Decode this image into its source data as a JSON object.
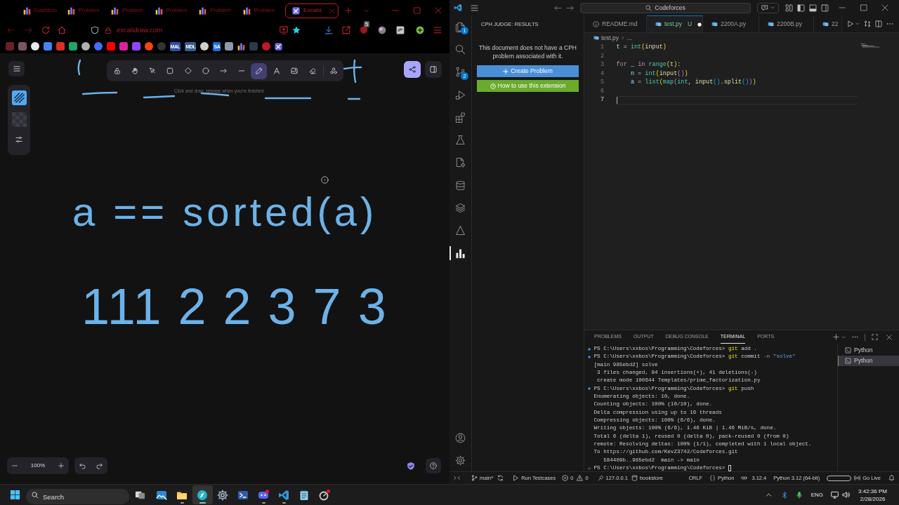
{
  "browser": {
    "tabs": [
      {
        "label": "Dashboo",
        "kind": "chart",
        "selected": false
      },
      {
        "label": "Problem",
        "kind": "chart",
        "selected": false
      },
      {
        "label": "Problem",
        "kind": "chart",
        "selected": false
      },
      {
        "label": "Problem",
        "kind": "chart",
        "selected": false
      },
      {
        "label": "Problem",
        "kind": "chart",
        "selected": false
      },
      {
        "label": "Problem",
        "kind": "chart",
        "selected": false
      },
      {
        "label": "Excalid",
        "kind": "excalidraw",
        "selected": true
      }
    ],
    "address": "excalidraw.com",
    "extension_badge": "5",
    "bookmarks": [
      {
        "kind": "tile",
        "color": "#6b1e28"
      },
      {
        "kind": "tile",
        "color": "#7a5560"
      },
      {
        "kind": "round",
        "color": "#e8eaed"
      },
      {
        "kind": "tile",
        "color": "#4285f4"
      },
      {
        "kind": "tile",
        "color": "#d93025"
      },
      {
        "kind": "tile",
        "color": "#1fa463"
      },
      {
        "kind": "round",
        "color": "#b0b0b0"
      },
      {
        "kind": "round",
        "color": "#4a6cf7"
      },
      {
        "kind": "tile",
        "color": "#ff0000"
      },
      {
        "kind": "tile",
        "color": "#d6249f"
      },
      {
        "kind": "tile",
        "color": "#9146ff"
      },
      {
        "kind": "round",
        "color": "#ff4500"
      },
      {
        "kind": "round",
        "color": "#333333"
      },
      {
        "kind": "label",
        "label": "MAL",
        "color": "#2e51a2"
      },
      {
        "kind": "label",
        "label": "MDL",
        "color": "#345f8f"
      },
      {
        "kind": "round",
        "color": "#cfcfcf"
      },
      {
        "kind": "label",
        "label": "SA",
        "color": "#1e6fd9"
      },
      {
        "kind": "tile",
        "color": "#8a9ba8"
      },
      {
        "kind": "chart"
      },
      {
        "kind": "tile",
        "color": "#2b3a4a"
      },
      {
        "kind": "round",
        "color": "#c0182a"
      },
      {
        "kind": "excalidraw"
      }
    ]
  },
  "excalidraw": {
    "tools": [
      {
        "kind": "lock",
        "selected": false
      },
      {
        "kind": "hand",
        "selected": false
      },
      {
        "kind": "selection",
        "selected": false
      },
      {
        "kind": "rectangle",
        "selected": false
      },
      {
        "kind": "diamond",
        "selected": false
      },
      {
        "kind": "ellipse",
        "selected": false
      },
      {
        "kind": "arrow",
        "selected": false
      },
      {
        "kind": "line",
        "selected": false
      },
      {
        "kind": "pencil",
        "selected": true
      },
      {
        "kind": "text",
        "selected": false
      },
      {
        "kind": "image",
        "selected": false
      },
      {
        "kind": "eraser",
        "selected": false
      },
      {
        "kind": "more",
        "selected": false
      }
    ],
    "hint": "Click and drag, release when you're finished",
    "drawing_texts": [
      "a == sorted(a)",
      "111 2 2 3 7 3"
    ],
    "zoom": "100%"
  },
  "vscode": {
    "command_center": "Codeforces",
    "activity": [
      {
        "kind": "explorer",
        "badge": "1",
        "selected": false
      },
      {
        "kind": "search",
        "selected": false
      },
      {
        "kind": "source_control",
        "badge": "2",
        "selected": false
      },
      {
        "kind": "run",
        "selected": false
      },
      {
        "kind": "extensions",
        "selected": false
      },
      {
        "kind": "testing",
        "selected": false
      },
      {
        "kind": "file_settings",
        "selected": false
      },
      {
        "kind": "database",
        "selected": false
      },
      {
        "kind": "layers",
        "selected": false
      },
      {
        "kind": "triangle",
        "selected": false
      },
      {
        "kind": "chart",
        "selected": true
      }
    ],
    "sidebar": {
      "title": "CPH JUDGE: RESULTS",
      "message": "This document does not have a CPH problem associated with it.",
      "buttons": [
        {
          "label": "Create Problem",
          "kind": "create"
        },
        {
          "label": "How to use this extension",
          "kind": "help"
        }
      ]
    },
    "editor_tabs": [
      {
        "label": "README.md",
        "kind": "info",
        "selected": false,
        "dirty": false
      },
      {
        "label": "test.py",
        "kind": "python",
        "selected": true,
        "status": "U",
        "dirty": true
      },
      {
        "label": "2200A.py",
        "kind": "python",
        "selected": false,
        "dirty": false
      },
      {
        "label": "2200B.py",
        "kind": "python",
        "selected": false,
        "dirty": false
      },
      {
        "label": "22",
        "kind": "python",
        "selected": false,
        "dirty": false
      }
    ],
    "breadcrumb": [
      "test.py",
      "..."
    ],
    "code": [
      {
        "number": "1",
        "current": false,
        "tokens": [
          {
            "text": "t",
            "kind": "var"
          },
          {
            "text": " = ",
            "kind": "op"
          },
          {
            "text": "int",
            "kind": "builtin"
          },
          {
            "text": "(",
            "kind": "paren1"
          },
          {
            "text": "input",
            "kind": "func"
          },
          {
            "text": ")",
            "kind": "paren1"
          }
        ]
      },
      {
        "number": "2",
        "current": false
      },
      {
        "number": "3",
        "current": false,
        "tokens": [
          {
            "text": "for",
            "kind": "keyword"
          },
          {
            "text": " _ ",
            "kind": "var"
          },
          {
            "text": "in",
            "kind": "keyword"
          },
          {
            "text": " range",
            "kind": "builtin"
          },
          {
            "text": "(",
            "kind": "paren1"
          },
          {
            "text": "t",
            "kind": "var"
          },
          {
            "text": ")",
            "kind": "paren1"
          },
          {
            "text": ":",
            "kind": "op"
          }
        ]
      },
      {
        "number": "4",
        "current": false,
        "tokens": [
          {
            "text": "    n",
            "kind": "var"
          },
          {
            "text": " = ",
            "kind": "op"
          },
          {
            "text": "int",
            "kind": "builtin"
          },
          {
            "text": "(",
            "kind": "paren1"
          },
          {
            "text": "input",
            "kind": "func"
          },
          {
            "text": "(",
            "kind": "paren2"
          },
          {
            "text": ")",
            "kind": "paren2"
          },
          {
            "text": ")",
            "kind": "paren1"
          }
        ]
      },
      {
        "number": "5",
        "current": false,
        "tokens": [
          {
            "text": "    a",
            "kind": "var"
          },
          {
            "text": " = ",
            "kind": "op"
          },
          {
            "text": "list",
            "kind": "builtin"
          },
          {
            "text": "(",
            "kind": "paren1"
          },
          {
            "text": "map",
            "kind": "builtin"
          },
          {
            "text": "(",
            "kind": "paren2"
          },
          {
            "text": "int",
            "kind": "builtin"
          },
          {
            "text": ", ",
            "kind": "op"
          },
          {
            "text": "input",
            "kind": "func"
          },
          {
            "text": "(",
            "kind": "paren3"
          },
          {
            "text": ")",
            "kind": "paren3"
          },
          {
            "text": ".",
            "kind": "op"
          },
          {
            "text": "split",
            "kind": "func"
          },
          {
            "text": "(",
            "kind": "paren3"
          },
          {
            "text": ")",
            "kind": "paren3"
          },
          {
            "text": ")",
            "kind": "paren2"
          },
          {
            "text": ")",
            "kind": "paren1"
          }
        ]
      },
      {
        "number": "6",
        "current": false
      },
      {
        "number": "7",
        "current": true
      }
    ],
    "panel": {
      "tabs": [
        {
          "label": "PROBLEMS",
          "selected": false
        },
        {
          "label": "OUTPUT",
          "selected": false
        },
        {
          "label": "DEBUG CONSOLE",
          "selected": false
        },
        {
          "label": "TERMINAL",
          "selected": true
        },
        {
          "label": "PORTS",
          "selected": false
        }
      ],
      "terminal": [
        {
          "kind": "success",
          "segments": [
            {
              "text": "PS C:\\Users\\xxbos\\Programming\\Codeforces> ",
              "kind": "plain"
            },
            {
              "text": "git",
              "kind": "command"
            },
            {
              "text": " add .",
              "kind": "plain"
            }
          ]
        },
        {
          "kind": "success",
          "segments": [
            {
              "text": "PS C:\\Users\\xxbos\\Programming\\Codeforces> ",
              "kind": "plain"
            },
            {
              "text": "git",
              "kind": "command"
            },
            {
              "text": " commit ",
              "kind": "plain"
            },
            {
              "text": "-m",
              "kind": "flag"
            },
            {
              "text": " \"solve\"",
              "kind": "string"
            }
          ]
        },
        {
          "kind": "output",
          "segments": [
            {
              "text": "[main 985ebd2] solve",
              "kind": "plain"
            }
          ]
        },
        {
          "kind": "output",
          "segments": [
            {
              "text": " 3 files changed, 84 insertions(+), 41 deletions(-)",
              "kind": "plain"
            }
          ]
        },
        {
          "kind": "output",
          "segments": [
            {
              "text": " create mode 100644 Templates/prime_factorization.py",
              "kind": "plain"
            }
          ]
        },
        {
          "kind": "success",
          "segments": [
            {
              "text": "PS C:\\Users\\xxbos\\Programming\\Codeforces> ",
              "kind": "plain"
            },
            {
              "text": "git",
              "kind": "command"
            },
            {
              "text": " push",
              "kind": "plain"
            }
          ]
        },
        {
          "kind": "output",
          "segments": [
            {
              "text": "Enumerating objects: 10, done.",
              "kind": "plain"
            }
          ]
        },
        {
          "kind": "output",
          "segments": [
            {
              "text": "Counting objects: 100% (10/10), done.",
              "kind": "plain"
            }
          ]
        },
        {
          "kind": "output",
          "segments": [
            {
              "text": "Delta compression using up to 16 threads",
              "kind": "plain"
            }
          ]
        },
        {
          "kind": "output",
          "segments": [
            {
              "text": "Compressing objects: 100% (6/6), done.",
              "kind": "plain"
            }
          ]
        },
        {
          "kind": "output",
          "segments": [
            {
              "text": "Writing objects: 100% (6/6), 1.46 KiB | 1.46 MiB/s, done.",
              "kind": "plain"
            }
          ]
        },
        {
          "kind": "output",
          "segments": [
            {
              "text": "Total 6 (delta 1), reused 0 (delta 0), pack-reused 0 (from 0)",
              "kind": "plain"
            }
          ]
        },
        {
          "kind": "output",
          "segments": [
            {
              "text": "remote: Resolving deltas: 100% (1/1), completed with 1 local object.",
              "kind": "plain"
            }
          ]
        },
        {
          "kind": "output",
          "segments": [
            {
              "text": "To https://github.com/KevZ3742/Codeforces.git",
              "kind": "plain"
            }
          ]
        },
        {
          "kind": "output",
          "segments": [
            {
              "text": "   584409b..985ebd2  main -> main",
              "kind": "plain"
            }
          ]
        },
        {
          "kind": "idle",
          "segments": [
            {
              "text": "PS C:\\Users\\xxbos\\Programming\\Codeforces> ",
              "kind": "plain"
            }
          ]
        }
      ],
      "cursor": true,
      "sessions": [
        {
          "label": "Python",
          "selected": false
        },
        {
          "label": "Python",
          "selected": true
        }
      ]
    },
    "status_bar": [
      {
        "kind": "remote"
      },
      {
        "kind": "branch",
        "text": "main*"
      },
      {
        "kind": "sync"
      },
      {
        "kind": "run",
        "text": "Run Testcases"
      },
      {
        "kind": "errors",
        "text": "0"
      },
      {
        "kind": "warnings",
        "text": "0"
      },
      {
        "kind": "server",
        "text": "127.0.0.1"
      },
      {
        "kind": "database",
        "text": "bookstore"
      },
      {
        "kind": "eol",
        "text": "CRLF"
      },
      {
        "kind": "language",
        "text": "Python"
      },
      {
        "kind": "goggles"
      },
      {
        "kind": "version",
        "text": "3.12.4"
      },
      {
        "kind": "interpreter",
        "text": "Python 3.12 (64-bit)"
      },
      {
        "kind": "pill"
      },
      {
        "kind": "live",
        "text": "Go Live"
      },
      {
        "kind": "bell"
      }
    ]
  },
  "taskbar": {
    "search": {
      "placeholder": "Search"
    },
    "apps": [
      {
        "kind": "photos",
        "selected": false,
        "running": false,
        "notification": false
      },
      {
        "kind": "folder",
        "selected": false,
        "running": true,
        "notification": false
      },
      {
        "kind": "compass",
        "selected": true,
        "running": true,
        "notification": false
      },
      {
        "kind": "settings",
        "selected": false,
        "running": false,
        "notification": false
      },
      {
        "kind": "terminal",
        "selected": false,
        "running": false,
        "notification": false
      },
      {
        "kind": "chat",
        "selected": false,
        "running": true,
        "notification": true
      },
      {
        "kind": "code",
        "selected": false,
        "running": true,
        "notification": false
      },
      {
        "kind": "notepad",
        "selected": false,
        "running": false,
        "notification": false
      },
      {
        "kind": "ring",
        "selected": false,
        "running": false,
        "notification": true
      }
    ],
    "language": "ENG",
    "time": "3:42:36 PM",
    "date": "2/28/2026"
  }
}
